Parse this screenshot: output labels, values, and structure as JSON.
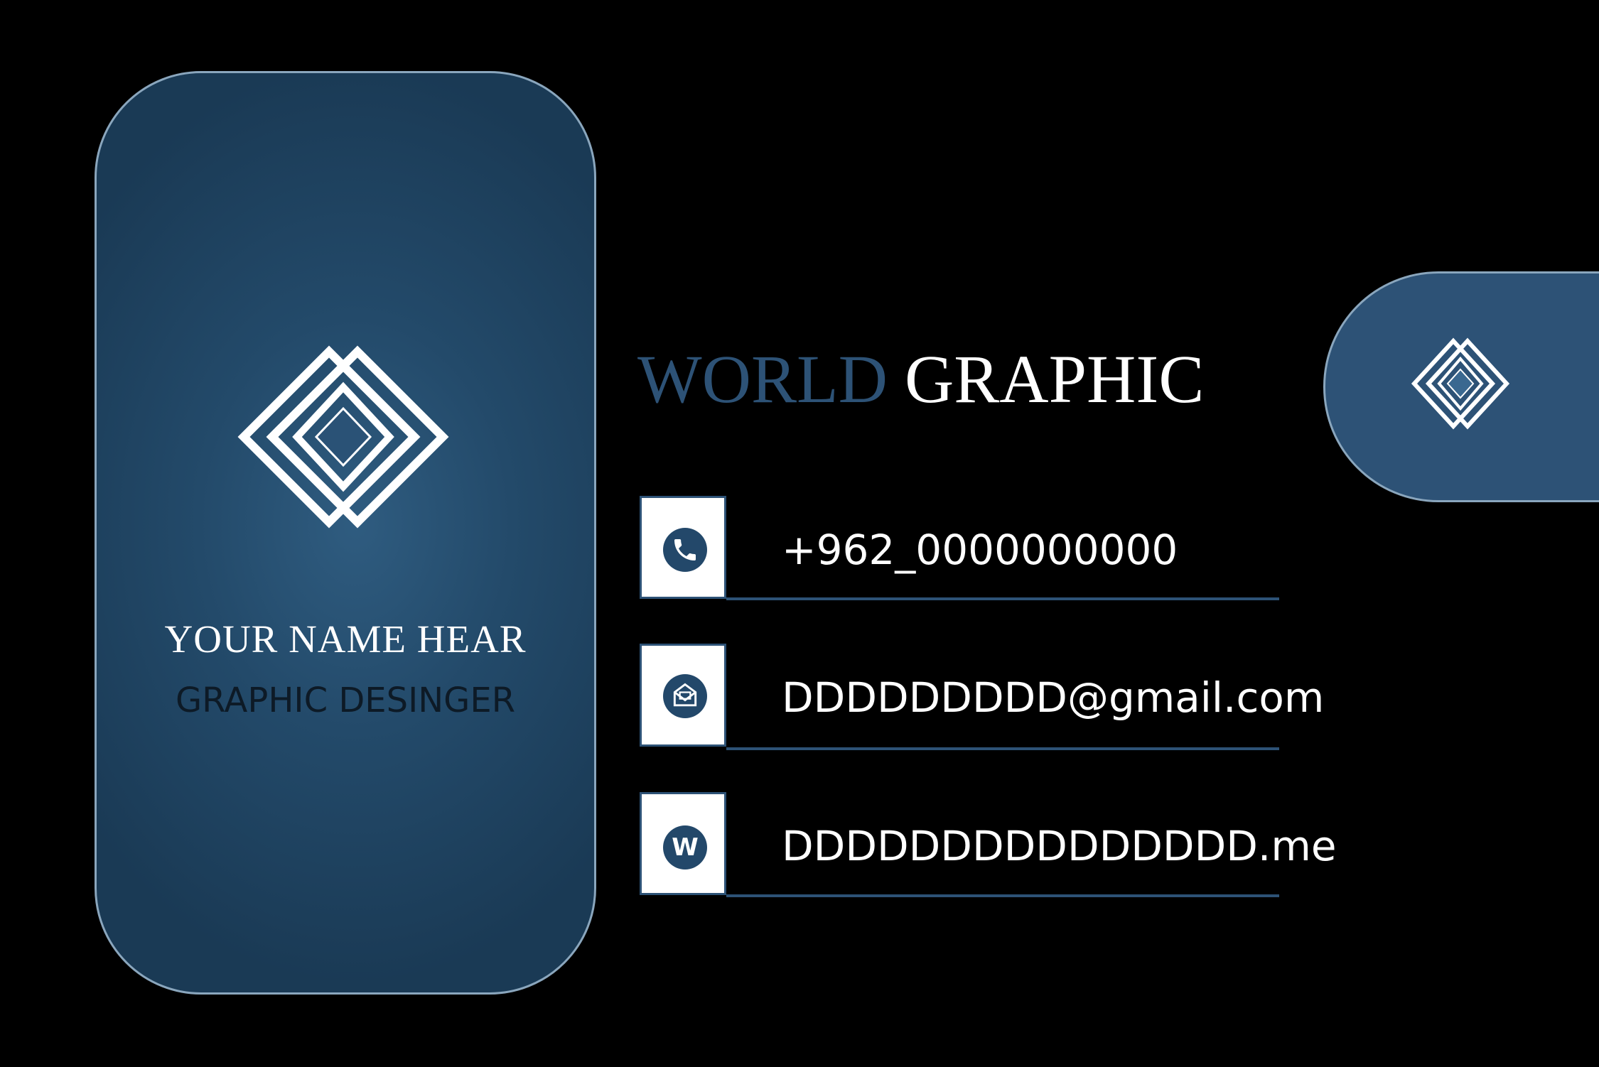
{
  "card": {
    "name": "YOUR NAME HEAR",
    "title": "GRAPHIC DESINGER",
    "brand": {
      "word1": "WORLD",
      "word2": "GRAPHIC"
    }
  },
  "contacts": [
    {
      "icon": "phone-icon",
      "text": "+962_0000000000"
    },
    {
      "icon": "mail-icon",
      "text": "DDDDDDDDD@gmail.com"
    },
    {
      "icon": "website-icon",
      "text": "DDDDDDDDDDDDDDD.me",
      "glyph": "W"
    }
  ],
  "colors": {
    "background": "#000000",
    "accent": "#2d5276",
    "panel": "#234a6a",
    "text_light": "#ffffff",
    "text_dark": "#0d1a26"
  }
}
